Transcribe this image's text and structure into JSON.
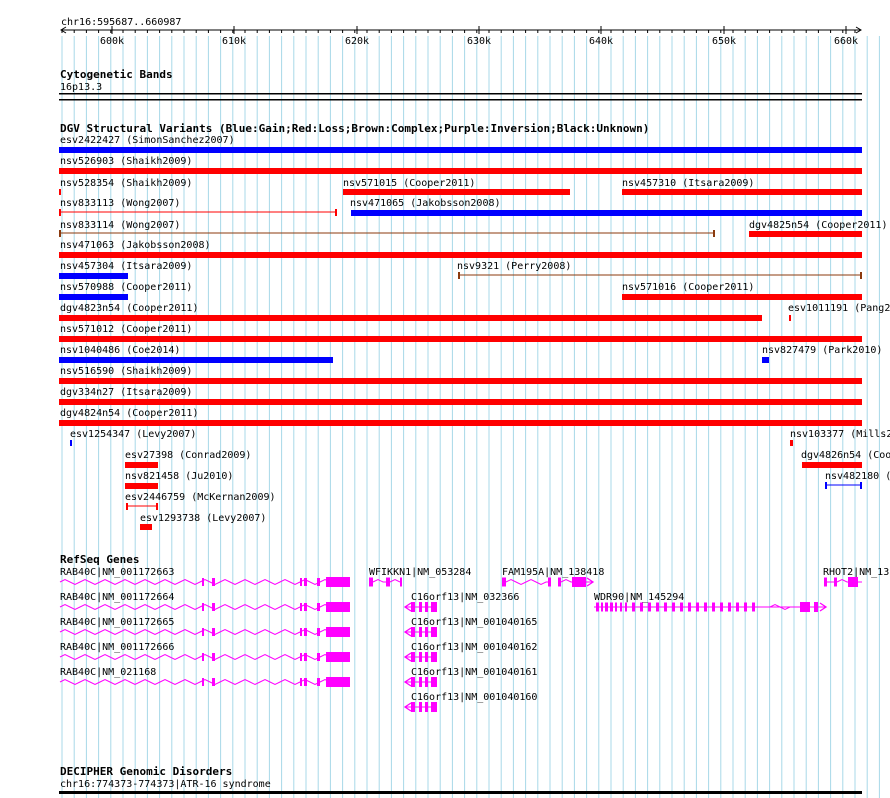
{
  "region": "chr16:595687..660987",
  "ruler_ticks": [
    "600k",
    "610k",
    "620k",
    "630k",
    "640k",
    "650k",
    "660k"
  ],
  "colors": {
    "gain": "#0000ff",
    "loss": "#ff0000",
    "complex": "#8b3a0e",
    "gene": "#ff00ff",
    "grid": "#a8d8e8",
    "text": "#000000"
  },
  "tracks": {
    "cytobands": {
      "title": "Cytogenetic Bands",
      "band": "16p13.3"
    },
    "dgv": {
      "title": "DGV Structural Variants (Blue:Gain;Red:Loss;Brown:Complex;Purple:Inversion;Black:Unknown)",
      "variants": [
        {
          "label": "esv2422427 (SimonSanchez2007)",
          "type": "gain"
        },
        {
          "label": "nsv526903 (Shaikh2009)",
          "type": "loss"
        },
        {
          "label": "nsv528354 (Shaikh2009)",
          "type": "loss"
        },
        {
          "label": "nsv571015 (Cooper2011)",
          "type": "loss"
        },
        {
          "label": "nsv457310 (Itsara2009)",
          "type": "loss"
        },
        {
          "label": "nsv833113 (Wong2007)",
          "type": "loss"
        },
        {
          "label": "nsv471065 (Jakobsson2008)",
          "type": "gain"
        },
        {
          "label": "nsv833114 (Wong2007)",
          "type": "complex"
        },
        {
          "label": "dgv4825n54 (Cooper2011)",
          "type": "loss"
        },
        {
          "label": "nsv471063 (Jakobsson2008)",
          "type": "loss"
        },
        {
          "label": "nsv457304 (Itsara2009)",
          "type": "gain"
        },
        {
          "label": "nsv9321 (Perry2008)",
          "type": "complex"
        },
        {
          "label": "nsv570988 (Cooper2011)",
          "type": "gain"
        },
        {
          "label": "nsv571016 (Cooper2011)",
          "type": "loss"
        },
        {
          "label": "dgv4823n54 (Cooper2011)",
          "type": "loss"
        },
        {
          "label": "esv1011191 (Pang2",
          "type": "loss"
        },
        {
          "label": "nsv571012 (Cooper2011)",
          "type": "loss"
        },
        {
          "label": "nsv1040486 (Coe2014)",
          "type": "gain"
        },
        {
          "label": "nsv827479 (Park2010)",
          "type": "gain"
        },
        {
          "label": "nsv516590 (Shaikh2009)",
          "type": "loss"
        },
        {
          "label": "dgv334n27 (Itsara2009)",
          "type": "loss"
        },
        {
          "label": "dgv4824n54 (Cooper2011)",
          "type": "loss"
        },
        {
          "label": "esv1254347 (Levy2007)",
          "type": "gain"
        },
        {
          "label": "nsv103377 (Mills2",
          "type": "loss"
        },
        {
          "label": "esv27398 (Conrad2009)",
          "type": "loss"
        },
        {
          "label": "dgv4826n54 (Coo",
          "type": "loss"
        },
        {
          "label": "nsv821458 (Ju2010)",
          "type": "loss"
        },
        {
          "label": "nsv482180 (",
          "type": "gain"
        },
        {
          "label": "esv2446759 (McKernan2009)",
          "type": "loss"
        },
        {
          "label": "esv1293738 (Levy2007)",
          "type": "loss"
        }
      ]
    },
    "refseq": {
      "title": "RefSeq Genes",
      "genes": [
        {
          "label": "RAB40C|NM_001172663"
        },
        {
          "label": "WFIKKN1|NM_053284"
        },
        {
          "label": "FAM195A|NM_138418"
        },
        {
          "label": "RHOT2|NM_13"
        },
        {
          "label": "RAB40C|NM_001172664"
        },
        {
          "label": "C16orf13|NM_032366"
        },
        {
          "label": "WDR90|NM_145294"
        },
        {
          "label": "RAB40C|NM_001172665"
        },
        {
          "label": "C16orf13|NM_001040165"
        },
        {
          "label": "RAB40C|NM_001172666"
        },
        {
          "label": "C16orf13|NM_001040162"
        },
        {
          "label": "RAB40C|NM_021168"
        },
        {
          "label": "C16orf13|NM_001040161"
        },
        {
          "label": "C16orf13|NM_001040160"
        }
      ]
    },
    "decipher": {
      "title": "DECIPHER Genomic Disorders",
      "feature": "chr16:774373-774373|ATR-16 syndrome"
    }
  }
}
